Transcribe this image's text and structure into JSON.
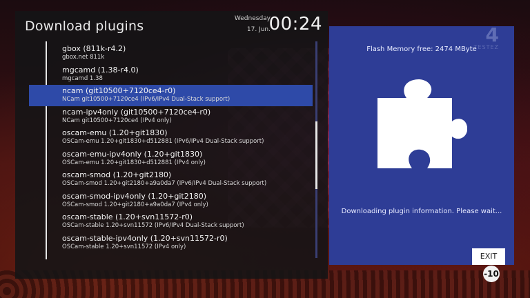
{
  "window": {
    "title": "Download plugins",
    "day": "Wednesday",
    "date": "17. Jun.",
    "time": "00:24"
  },
  "plugins": [
    {
      "name": "gbox  (811k-r4.2)",
      "desc": "gbox.net 811k"
    },
    {
      "name": "mgcamd  (1.38-r4.0)",
      "desc": "mgcamd 1.38"
    },
    {
      "name": "ncam  (git10500+7120ce4-r0)",
      "desc": "NCam git10500+7120ce4 (IPv6/IPv4 Dual-Stack support)",
      "selected": true
    },
    {
      "name": "ncam-ipv4only  (git10500+7120ce4-r0)",
      "desc": "NCam git10500+7120ce4 (IPv4 only)"
    },
    {
      "name": "oscam-emu  (1.20+git1830)",
      "desc": "OSCam-emu 1.20+git1830+d512881 (IPv6/IPv4 Dual-Stack support)"
    },
    {
      "name": "oscam-emu-ipv4only  (1.20+git1830)",
      "desc": "OSCam-emu 1.20+git1830+d512881 (IPv4 only)"
    },
    {
      "name": "oscam-smod  (1.20+git2180)",
      "desc": "OSCam-smod 1.20+git2180+a9a0da7 (IPv6/IPv4 Dual-Stack support)"
    },
    {
      "name": "oscam-smod-ipv4only  (1.20+git2180)",
      "desc": "OSCam-smod 1.20+git2180+a9a0da7 (IPv4 only)"
    },
    {
      "name": "oscam-stable  (1.20+svn11572-r0)",
      "desc": "OSCam-stable 1.20+svn11572 (IPv6/IPv4 Dual-Stack support)"
    },
    {
      "name": "oscam-stable-ipv4only  (1.20+svn11572-r0)",
      "desc": "OSCam-stable 1.20+svn11572 (IPv4 only)"
    }
  ],
  "info_panel": {
    "flash_memory": "Flash Memory free: 2474 MByte",
    "status": "Downloading plugin information. Please wait...",
    "icon": "puzzle-piece-icon",
    "background_color": "#2e3d96",
    "logo_number": "4",
    "logo_text": "TESTEZ"
  },
  "buttons": {
    "exit": "EXIT"
  },
  "age_rating": "-10",
  "colors": {
    "selection": "#2e4aa8",
    "panel": "#2e3d96"
  }
}
